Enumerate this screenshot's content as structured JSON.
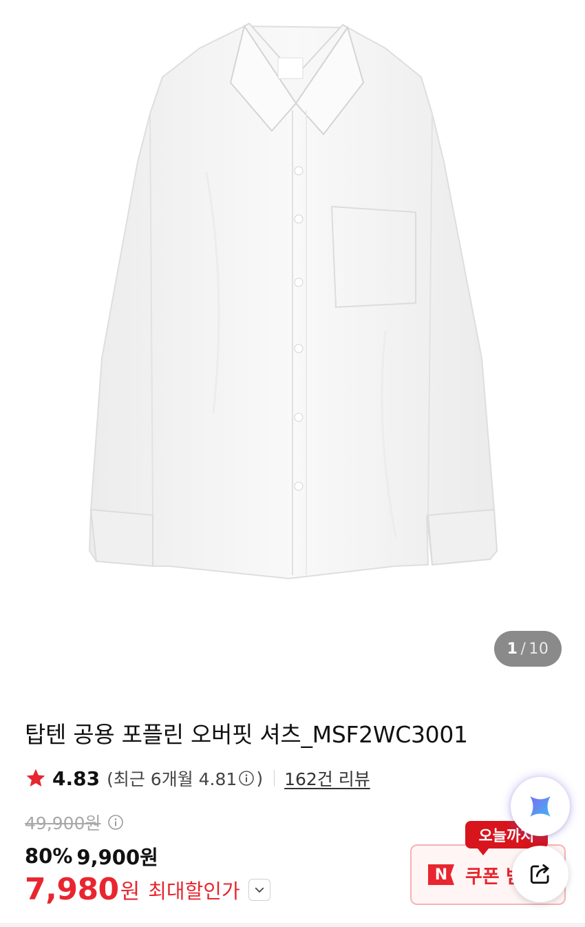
{
  "gallery": {
    "current_page": "1",
    "separator": "/",
    "total_pages": "10"
  },
  "product": {
    "title": "탑텐 공용 포플린 오버핏 셔츠_MSF2WC3001"
  },
  "rating": {
    "score": "4.83",
    "recent_open": "(최근 6개월 4.81",
    "recent_close": ")",
    "reviews_link": "162건 리뷰"
  },
  "price": {
    "original": "49,900원",
    "discount_percent": "80%",
    "sale_price": "9,900원",
    "final_price": "7,980",
    "final_unit": "원",
    "final_label": "최대할인가"
  },
  "coupon": {
    "today_tag": "오늘까지",
    "badge": "N",
    "label": "쿠폰 받"
  },
  "colors": {
    "accent_red": "#e8262f",
    "star": "#e8262f",
    "counter_bg": "#8a8a8a"
  },
  "icons": {
    "star": "star-icon",
    "info": "info-icon",
    "dropdown": "chevron-down-icon",
    "ai": "ai-sparkle-icon",
    "share": "share-icon"
  }
}
